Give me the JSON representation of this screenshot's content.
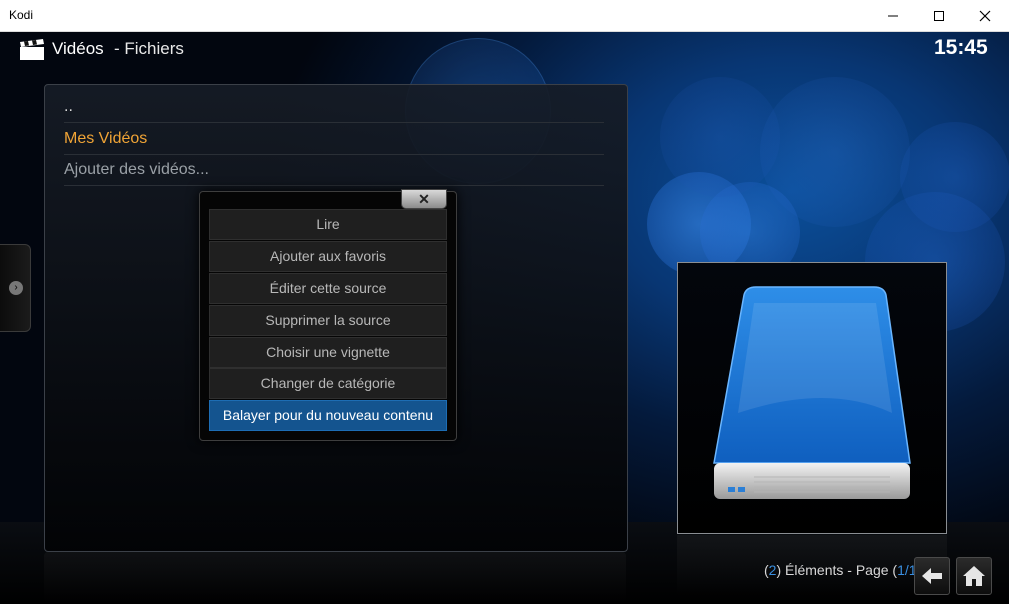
{
  "window": {
    "title": "Kodi",
    "minimize_icon": "minimize-icon",
    "maximize_icon": "maximize-icon",
    "close_icon": "close-icon"
  },
  "header": {
    "section_icon": "clapperboard-icon",
    "title": "Vidéos",
    "subtitle": "- Fichiers",
    "clock": "15:45"
  },
  "list": {
    "items": [
      {
        "label": ".."
      },
      {
        "label": "Mes Vidéos"
      },
      {
        "label": "Ajouter des vidéos..."
      }
    ],
    "selected_color": "#f0a436"
  },
  "context_menu": {
    "close_label": "✕",
    "items": [
      {
        "label": "Lire"
      },
      {
        "label": "Ajouter aux favoris"
      },
      {
        "label": "Éditer cette source"
      },
      {
        "label": "Supprimer la source"
      },
      {
        "label": "Choisir une vignette"
      },
      {
        "label": "Changer de catégorie"
      },
      {
        "label": "Balayer pour du nouveau contenu"
      }
    ],
    "selected_index": 6,
    "selected_color": "#14548f"
  },
  "thumbnail": {
    "icon": "hard-drive-icon"
  },
  "footer": {
    "count_open": "(",
    "count": "2",
    "count_text": ") Éléments - Page (",
    "page": "1/1",
    "count_close": ")",
    "back_icon": "back-arrow-icon",
    "home_icon": "home-icon"
  },
  "side_tab": {
    "icon": "chevron-right-icon"
  }
}
